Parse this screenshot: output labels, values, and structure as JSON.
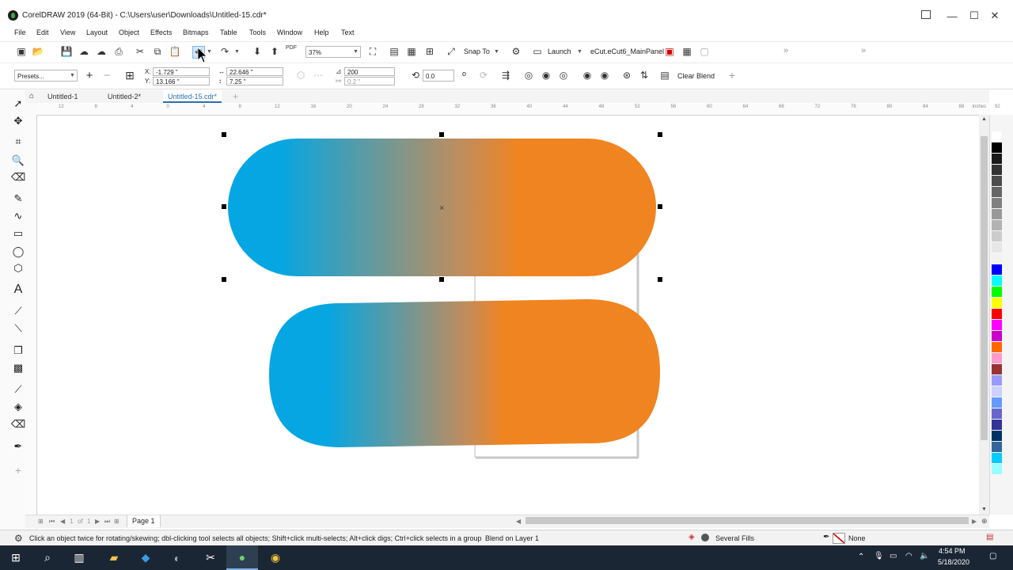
{
  "window": {
    "title": "CorelDRAW 2019 (64-Bit) - C:\\Users\\user\\Downloads\\Untitled-15.cdr*",
    "minimize": "—",
    "maximize": "☐",
    "close": "✕"
  },
  "menu": [
    "File",
    "Edit",
    "View",
    "Layout",
    "Object",
    "Effects",
    "Bitmaps",
    "Table",
    "Tools",
    "Window",
    "Help",
    "Text"
  ],
  "toolbar": {
    "zoom": "37%",
    "snap_to": "Snap To",
    "launch": "Launch",
    "macro": "eCut.eCut6_MainPanel",
    "pdf_badge": "PDF"
  },
  "property_bar": {
    "presets": "Presets...",
    "x_label": "X:",
    "x_value": "-1.729 \"",
    "y_label": "Y:",
    "y_value": "13.166 \"",
    "width": "22.646 \"",
    "height": "7.25 \"",
    "steps": "200",
    "spacing": "0.2 \"",
    "rotation": "0.0",
    "degree_mark": "o",
    "clear_blend": "Clear Blend"
  },
  "tabs": [
    {
      "label": "Untitled-1",
      "active": false
    },
    {
      "label": "Untitled-2*",
      "active": false
    },
    {
      "label": "Untitled-15.cdr*",
      "active": true
    }
  ],
  "ruler": {
    "unit": "inches",
    "h_labels": [
      "12",
      "8",
      "4",
      "0",
      "4",
      "8",
      "12",
      "16",
      "20",
      "24",
      "28",
      "32",
      "36",
      "40",
      "44",
      "48",
      "52",
      "56",
      "60",
      "64",
      "68",
      "72",
      "76",
      "80",
      "84",
      "88",
      "92"
    ]
  },
  "blend": {
    "start_color": "#05a6e2",
    "end_color": "#f08420"
  },
  "page_nav": {
    "current": "1",
    "of_label": "of",
    "total": "1",
    "page_tab": "Page 1"
  },
  "status": {
    "hint": "Click an object twice for rotating/skewing; dbl-clicking tool selects all objects; Shift+click multi-selects; Alt+click digs; Ctrl+click selects in a group",
    "selection": "Blend on Layer 1",
    "fill": "Several Fills",
    "outline": "None"
  },
  "palette": [
    "#ffffff",
    "#000000",
    "#1a1a1a",
    "#333333",
    "#4d4d4d",
    "#666666",
    "#808080",
    "#999999",
    "#b3b3b3",
    "#cccccc",
    "#e6e6e6",
    "#f2f2f2",
    "#0000ff",
    "#00ffff",
    "#00ff00",
    "#ffff00",
    "#ff0000",
    "#ff00ff",
    "#cc00cc",
    "#ff6600",
    "#ff99cc",
    "#993333",
    "#9999ff",
    "#cccfff",
    "#6699ff",
    "#6666cc",
    "#333399",
    "#003366",
    "#336699",
    "#00ccff",
    "#99ffff"
  ],
  "taskbar": {
    "time": "4:54 PM",
    "date": "5/18/2020"
  }
}
